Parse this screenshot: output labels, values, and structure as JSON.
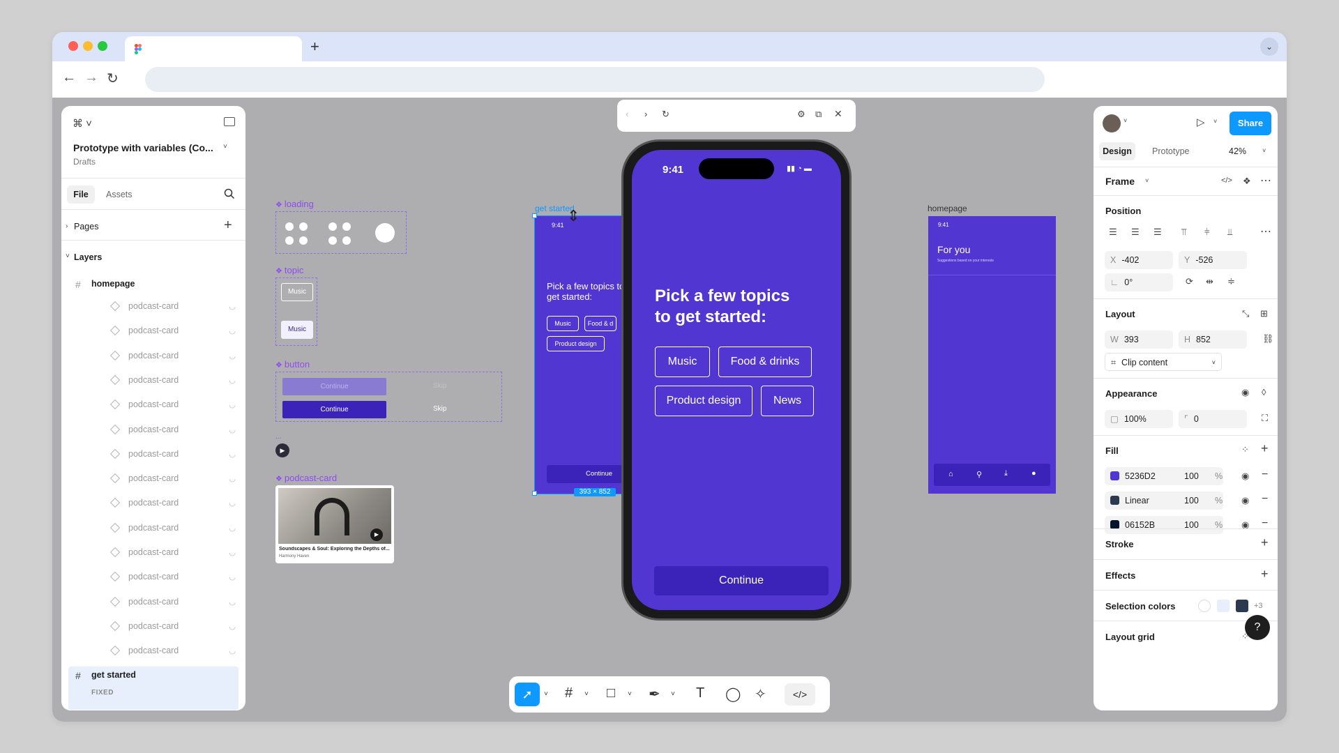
{
  "browser": {
    "new_tab": "+",
    "tab_menu": "⌄",
    "back": "←",
    "forward": "→",
    "reload": "↻"
  },
  "left_panel": {
    "file_title": "Prototype with variables (Co...",
    "file_location": "Drafts",
    "tabs": [
      "File",
      "Assets"
    ],
    "pages_label": "Pages",
    "layers_label": "Layers",
    "frame_homepage": "homepage",
    "layers": [
      "podcast-card",
      "podcast-card",
      "podcast-card",
      "podcast-card",
      "podcast-card",
      "podcast-card",
      "podcast-card",
      "podcast-card",
      "podcast-card",
      "podcast-card",
      "podcast-card",
      "podcast-card",
      "podcast-card",
      "podcast-card",
      "podcast-card"
    ],
    "frame_get_started": "get started",
    "fixed_label": "FIXED"
  },
  "canvas": {
    "comp_loading": "loading",
    "comp_topic": "topic",
    "topic_chip": "Music",
    "comp_button": "button",
    "btn_continue": "Continue",
    "btn_skip": "Skip",
    "ellipsis": "...",
    "comp_podcast": "podcast-card",
    "podcast_title": "Soundscapes & Soul: Exploring the Depths of...",
    "podcast_author": "Harmony Haven",
    "frame_get_started_label": "get started",
    "mini_time": "9:41",
    "mini_heading": "Pick a few topics to get started:",
    "mini_chips": [
      "Music",
      "Food & d",
      "Product design"
    ],
    "mini_continue": "Continue",
    "size_badge": "393 × 852",
    "frame_homepage_label": "homepage",
    "home_time": "9:41",
    "home_title": "For you",
    "home_subtitle": "Suggestions based on your interests"
  },
  "preview": {
    "time": "9:41",
    "heading_line1": "Pick a few topics",
    "heading_line2": "to get started:",
    "chips": [
      "Music",
      "Food & drinks",
      "Product design",
      "News"
    ],
    "continue": "Continue"
  },
  "right_panel": {
    "share": "Share",
    "tabs": [
      "Design",
      "Prototype"
    ],
    "zoom": "42%",
    "frame_label": "Frame",
    "position_label": "Position",
    "x_key": "X",
    "x_val": "-402",
    "y_key": "Y",
    "y_val": "-526",
    "rot_val": "0°",
    "layout_label": "Layout",
    "w_key": "W",
    "w_val": "393",
    "h_key": "H",
    "h_val": "852",
    "clip_content": "Clip content",
    "appearance_label": "Appearance",
    "opacity_val": "100%",
    "radius_val": "0",
    "fill_label": "Fill",
    "fills": [
      {
        "name": "5236D2",
        "opacity": "100",
        "pct": "%",
        "color": "#5236d2"
      },
      {
        "name": "Linear",
        "opacity": "100",
        "pct": "%",
        "color": "#2b3a4e"
      },
      {
        "name": "06152B",
        "opacity": "100",
        "pct": "%",
        "color": "#06152b"
      }
    ],
    "stroke_label": "Stroke",
    "effects_label": "Effects",
    "selection_colors_label": "Selection colors",
    "selection_more": "+3",
    "layout_grid_label": "Layout grid",
    "help": "?"
  },
  "colors": {
    "accent": "#0d99ff",
    "brand_purple": "#5236d2",
    "component_purple": "#8f4bf2"
  }
}
